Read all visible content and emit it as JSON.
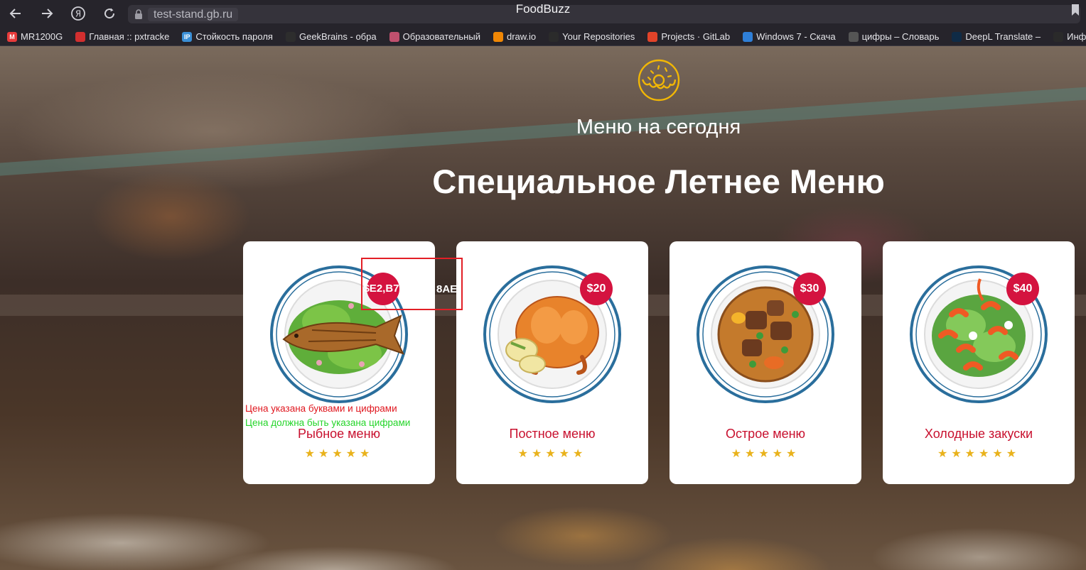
{
  "browser": {
    "url": "test-stand.gb.ru",
    "title": "FoodBuzz",
    "back_icon": "arrow-left",
    "forward_icon": "arrow-right",
    "yandex_icon": "Я",
    "reload_icon": "reload",
    "bookmarks": [
      {
        "label": "MR1200G",
        "color": "#e83b3b",
        "glyph": "M"
      },
      {
        "label": "Главная :: pxtracke",
        "color": "#d22f2f",
        "glyph": ""
      },
      {
        "label": "Стойкость пароля",
        "color": "#3a8fd6",
        "glyph": "IP"
      },
      {
        "label": "GeekBrains - обра",
        "color": "#2d2d2d",
        "glyph": ""
      },
      {
        "label": "Образовательный",
        "color": "#c0506e",
        "glyph": ""
      },
      {
        "label": "draw.io",
        "color": "#f08705",
        "glyph": ""
      },
      {
        "label": "Your Repositories",
        "color": "#2b2b2b",
        "glyph": ""
      },
      {
        "label": "Projects · GitLab",
        "color": "#e24329",
        "glyph": ""
      },
      {
        "label": "Windows 7 - Скача",
        "color": "#2f7fd8",
        "glyph": ""
      },
      {
        "label": "цифры – Словарь",
        "color": "#555555",
        "glyph": ""
      },
      {
        "label": "DeepL Translate –",
        "color": "#0f2b46",
        "glyph": ""
      },
      {
        "label": "Информация о",
        "color": "#2a2a2a",
        "glyph": ""
      }
    ]
  },
  "page": {
    "subtitle": "Меню на сегодня",
    "title": "Специальное Летнее Меню",
    "cards": [
      {
        "price": "$E2,B7",
        "name": "Рыбное меню",
        "stars": "★★★★★",
        "dish": "fish"
      },
      {
        "price": "$20",
        "name": "Постное меню",
        "stars": "★★★★★",
        "dish": "chicken"
      },
      {
        "price": "$30",
        "name": "Острое меню",
        "stars": "★★★★★",
        "dish": "stew"
      },
      {
        "price": "$40",
        "name": "Холодные закуски",
        "stars": "★★★★★★",
        "dish": "salad"
      }
    ],
    "price_overflow_text": "8AE",
    "annotation_error": "Цена указана буквами и цифрами",
    "annotation_expected": "Цена должна быть указана цифрами"
  },
  "colors": {
    "accent": "#d4133f",
    "stars": "#e9b21b",
    "annotation_box": "#e21f26",
    "error_text": "#e0171f",
    "expected_text": "#25d52a"
  }
}
